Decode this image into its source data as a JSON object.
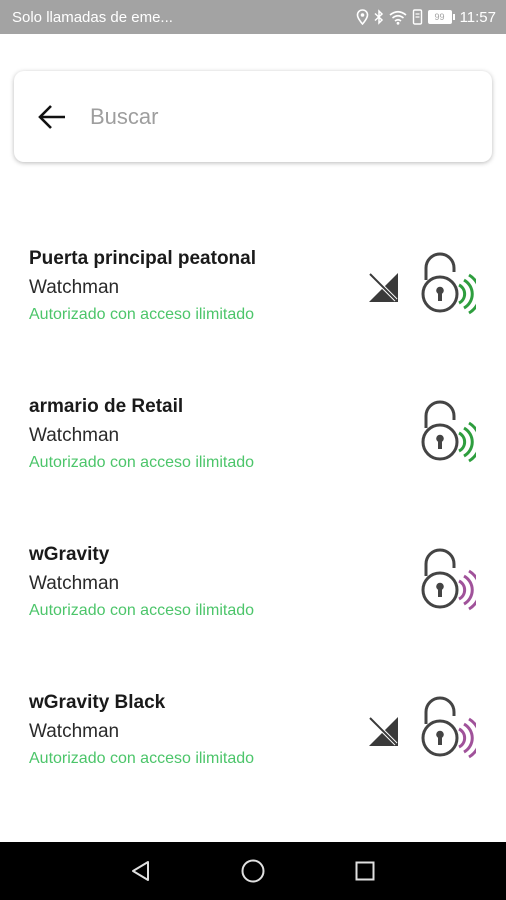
{
  "status_bar": {
    "carrier_text": "Solo llamadas de eme...",
    "battery_level": "99",
    "time": "11:57",
    "icons": [
      "location-icon",
      "bluetooth-icon",
      "wifi-icon",
      "vibrate-icon",
      "battery-icon"
    ]
  },
  "search": {
    "placeholder": "Buscar",
    "value": ""
  },
  "colors": {
    "status_green": "#4cc56a",
    "signal_green": "#2e9e3e",
    "signal_purple": "#a0529a",
    "status_bar_bg": "#a3a3a3",
    "nav_bar_bg": "#000000"
  },
  "locks": [
    {
      "name": "Puerta principal peatonal",
      "organization": "Watchman",
      "status": "Autorizado con acceso ilimitado",
      "no_signal": true,
      "signal_color": "green"
    },
    {
      "name": "armario de Retail",
      "organization": "Watchman",
      "status": "Autorizado con acceso ilimitado",
      "no_signal": false,
      "signal_color": "green"
    },
    {
      "name": "wGravity",
      "organization": "Watchman",
      "status": "Autorizado con acceso ilimitado",
      "no_signal": false,
      "signal_color": "purple"
    },
    {
      "name": "wGravity Black",
      "organization": "Watchman",
      "status": "Autorizado con acceso ilimitado",
      "no_signal": true,
      "signal_color": "purple"
    }
  ],
  "nav_bar": {
    "buttons": [
      "back-icon",
      "home-icon",
      "recents-icon"
    ]
  }
}
